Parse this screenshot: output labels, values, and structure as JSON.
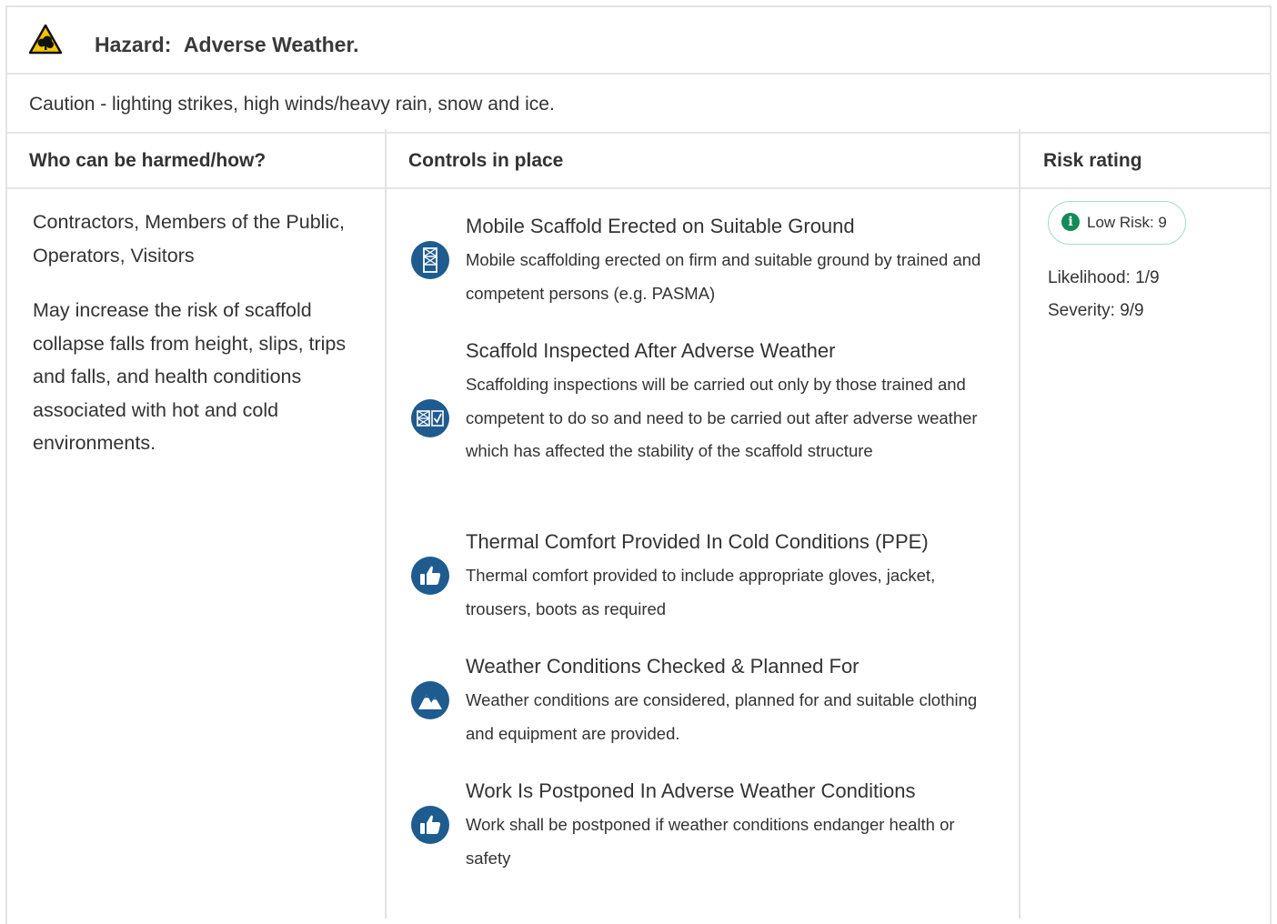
{
  "hazard": {
    "icon": "tree-warning-icon",
    "label": "Hazard:",
    "name": "Adverse Weather.",
    "caution": "Caution - lighting strikes, high winds/heavy rain, snow and ice."
  },
  "table": {
    "headers": [
      "Who can be harmed/how?",
      "Controls in place",
      "Risk rating"
    ]
  },
  "harmed": {
    "who": "Contractors, Members of the Public, Operators, Visitors",
    "how": "May increase the risk of scaffold collapse falls from height, slips, trips and falls, and health conditions associated with hot and cold environments."
  },
  "controls": [
    {
      "title": "Mobile Scaffold Erected on Suitable Ground",
      "description": "Mobile scaffolding erected on firm and suitable ground by trained and competent persons (e.g. PASMA)",
      "icon": "scaffold-icon"
    },
    {
      "title": "Scaffold Inspected After Adverse Weather",
      "description": "Scaffolding inspections will be carried out only by those trained and competent to do so and need to be carried out after adverse weather which has affected the stability of the scaffold structure",
      "icon": "scaffold-check-icon"
    },
    {
      "title": "Thermal Comfort Provided In Cold Conditions (PPE)",
      "description": "Thermal comfort provided to include appropriate gloves, jacket, trousers, boots as required",
      "icon": "thumbs-up-icon"
    },
    {
      "title": "Weather Conditions Checked & Planned For",
      "description": "Weather conditions are considered, planned for and suitable clothing and equipment are provided.",
      "icon": "mountains-icon"
    },
    {
      "title": "Work Is Postponed In Adverse Weather Conditions",
      "description": "Work shall be postponed if weather conditions endanger health or safety",
      "icon": "thumbs-up-icon"
    }
  ],
  "risk": {
    "badge": "Low Risk: 9",
    "likelihood": "Likelihood: 1/9",
    "severity": "Severity: 9/9",
    "badge_color": "#138a5a",
    "icon_color": "#1e5b8f"
  }
}
